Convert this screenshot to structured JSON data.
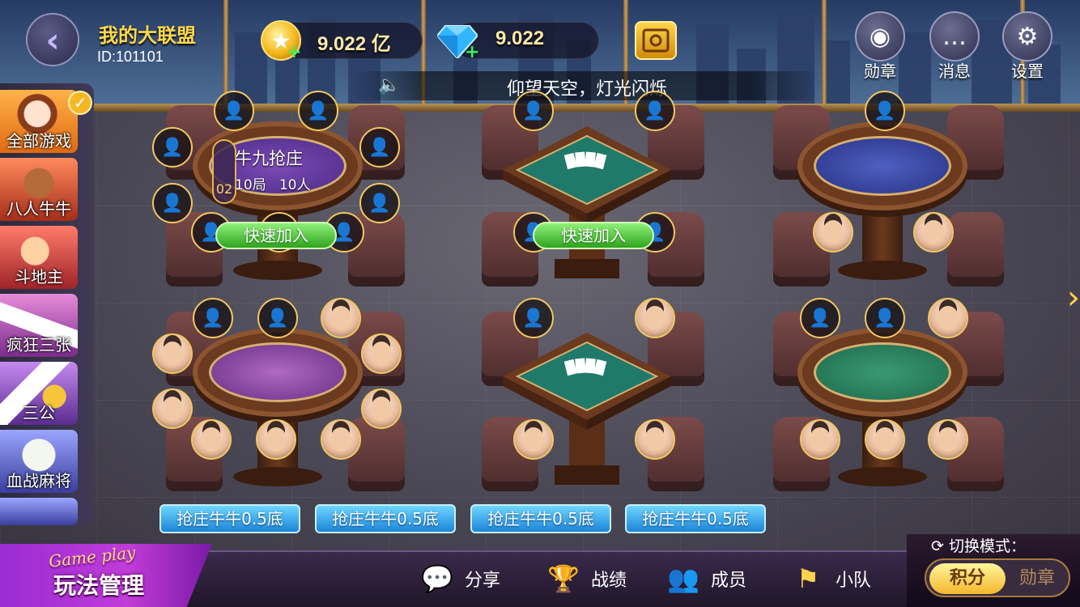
{
  "header": {
    "club_name": "我的大联盟",
    "club_id": "ID:101101",
    "gold": "9.022 亿",
    "diamonds": "9.022",
    "notice": "仰望天空，灯光闪烁",
    "buttons": [
      {
        "label": "勋章",
        "icon": "medal-icon"
      },
      {
        "label": "消息",
        "icon": "message-icon"
      },
      {
        "label": "设置",
        "icon": "gear-icon"
      }
    ]
  },
  "sidebar": {
    "selected": "全部游戏",
    "items": [
      {
        "label": "全部游戏",
        "icon": "avatar-girl-icon"
      },
      {
        "label": "八人牛牛",
        "icon": "bull-icon"
      },
      {
        "label": "斗地主",
        "icon": "landlord-icon"
      },
      {
        "label": "疯狂三张",
        "icon": "cards-icon"
      },
      {
        "label": "三公",
        "icon": "mahjong-tile-icon"
      },
      {
        "label": "血战麻将",
        "icon": "mahjong-icon"
      }
    ]
  },
  "tables": {
    "t1": {
      "game": "牛九抢庄",
      "rounds": "10局",
      "players": "10人",
      "index": "02",
      "quick_join": "快速加入"
    },
    "t2": {
      "quick_join": "快速加入"
    }
  },
  "bottom_rules": [
    "抢庄牛牛0.5底",
    "抢庄牛牛0.5底",
    "抢庄牛牛0.5底",
    "抢庄牛牛0.5底"
  ],
  "footer": {
    "play_en": "Game play",
    "play_cn": "玩法管理",
    "items": [
      {
        "label": "分享",
        "icon": "wechat-icon"
      },
      {
        "label": "战绩",
        "icon": "trophy-icon"
      },
      {
        "label": "成员",
        "icon": "members-icon"
      },
      {
        "label": "小队",
        "icon": "flag-icon"
      }
    ],
    "mode_title": "切换模式：",
    "mode_on": "积分",
    "mode_off": "勋章"
  },
  "colors": {
    "accent": "#ffd54a",
    "quick_join": "#2fa31e",
    "rule_button": "#1c84d8",
    "mode_active": "#f3b72d"
  }
}
